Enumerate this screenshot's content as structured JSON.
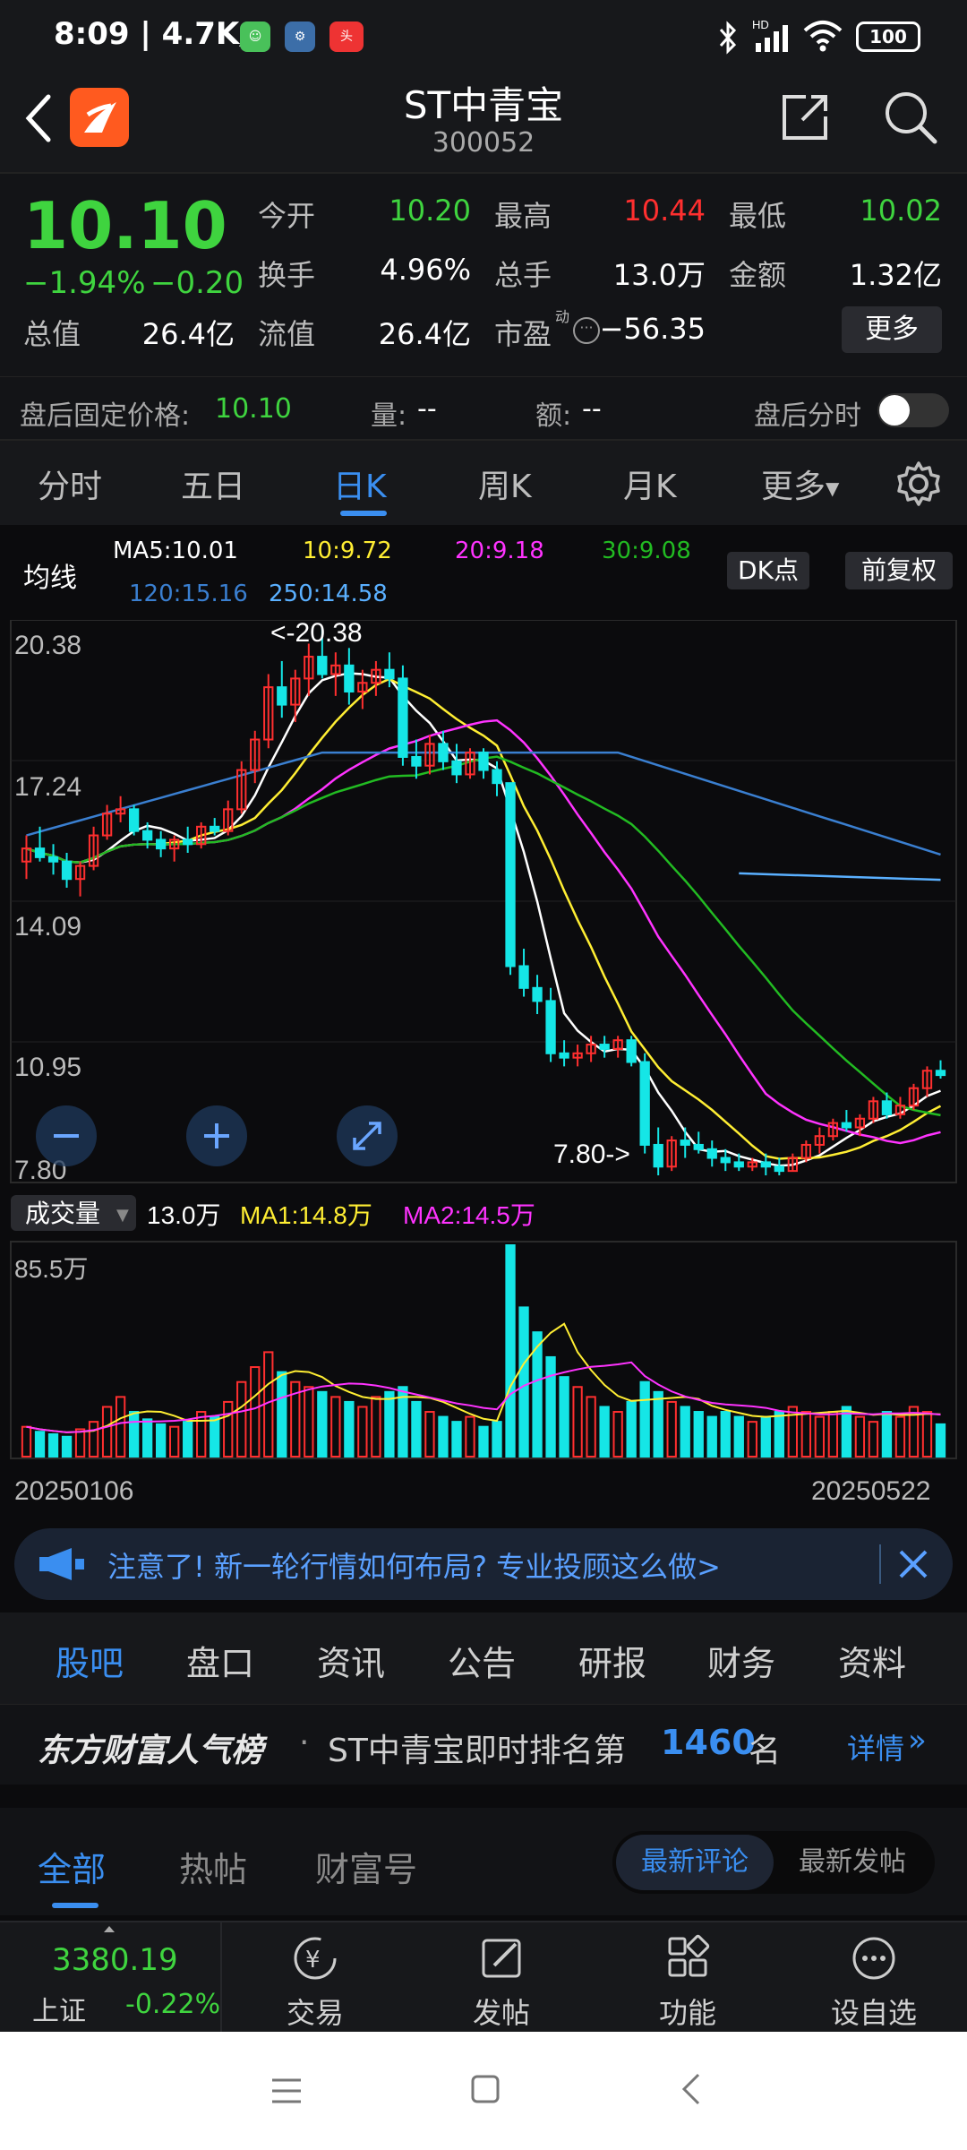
{
  "status": {
    "time": "8:09 | 4.7K/s",
    "battery": "100",
    "net": "HD"
  },
  "header": {
    "title": "ST中青宝",
    "code": "300052"
  },
  "quote": {
    "price": "10.10",
    "change_pct": "−1.94%",
    "change": "−0.20",
    "open_label": "今开",
    "open": "10.20",
    "high_label": "最高",
    "high": "10.44",
    "low_label": "最低",
    "low": "10.02",
    "turnover_label": "换手",
    "turnover": "4.96%",
    "volume_label": "总手",
    "volume": "13.0万",
    "amount_label": "金额",
    "amount": "1.32亿",
    "mktcap_label": "总值",
    "mktcap": "26.4亿",
    "float_label": "流值",
    "float": "26.4亿",
    "pe_label": "市盈",
    "pe_sup": "动",
    "pe": "−56.35",
    "more_button": "更多"
  },
  "after_hours": {
    "fixed_label": "盘后固定价格:",
    "fixed_value": "10.10",
    "qty_label": "量:",
    "qty_value": "--",
    "amt_label": "额:",
    "amt_value": "--",
    "intraday_label": "盘后分时"
  },
  "chart_tabs": [
    {
      "label": "分时"
    },
    {
      "label": "五日"
    },
    {
      "label": "日K"
    },
    {
      "label": "周K"
    },
    {
      "label": "月K"
    },
    {
      "label": "更多"
    }
  ],
  "ma_legend": {
    "label": "均线",
    "ma5": "MA5:10.01",
    "ma10": "10:9.72",
    "ma20": "20:9.18",
    "ma30": "30:9.08",
    "ma120": "120:15.16",
    "ma250": "250:14.58",
    "dk_button": "DK点",
    "adjust_button": "前复权"
  },
  "colors": {
    "up": "#ff2f2f",
    "down": "#15e6e6",
    "ma5": "#ffffff",
    "ma10": "#ffee33",
    "ma20": "#ff33ff",
    "ma30": "#22bb22",
    "ma120": "#3a7fd0",
    "ma250": "#5ab0ff",
    "accent": "#3a8ef0"
  },
  "chart_data": {
    "type": "candlestick",
    "y_ticks": [
      "20.38",
      "17.24",
      "14.09",
      "10.95",
      "7.80"
    ],
    "ylim": [
      7.8,
      20.38
    ],
    "max_marker": "<-20.38",
    "min_marker": "7.80->",
    "x_start": "20250106",
    "x_end": "20250522",
    "candles": [
      [
        15.0,
        15.6,
        14.6,
        15.3
      ],
      [
        15.3,
        15.8,
        15.0,
        15.1
      ],
      [
        15.1,
        15.4,
        14.7,
        15.0
      ],
      [
        15.0,
        15.2,
        14.4,
        14.6
      ],
      [
        14.6,
        15.0,
        14.2,
        14.9
      ],
      [
        14.9,
        15.8,
        14.8,
        15.6
      ],
      [
        15.6,
        16.3,
        15.5,
        16.1
      ],
      [
        16.1,
        16.5,
        15.9,
        16.2
      ],
      [
        16.2,
        16.3,
        15.6,
        15.7
      ],
      [
        15.7,
        15.9,
        15.3,
        15.5
      ],
      [
        15.5,
        15.7,
        15.1,
        15.3
      ],
      [
        15.3,
        15.6,
        15.0,
        15.5
      ],
      [
        15.5,
        15.8,
        15.2,
        15.4
      ],
      [
        15.4,
        15.9,
        15.3,
        15.8
      ],
      [
        15.8,
        16.0,
        15.6,
        15.7
      ],
      [
        15.7,
        16.4,
        15.6,
        16.2
      ],
      [
        16.2,
        17.3,
        16.1,
        17.1
      ],
      [
        17.1,
        18.0,
        16.8,
        17.8
      ],
      [
        17.8,
        19.3,
        17.6,
        19.0
      ],
      [
        19.0,
        19.6,
        18.3,
        18.6
      ],
      [
        18.6,
        19.4,
        18.2,
        19.2
      ],
      [
        19.2,
        20.0,
        18.8,
        19.7
      ],
      [
        19.7,
        20.38,
        19.2,
        19.3
      ],
      [
        19.3,
        19.8,
        18.8,
        19.5
      ],
      [
        19.5,
        19.9,
        18.6,
        18.9
      ],
      [
        18.9,
        19.4,
        18.5,
        19.1
      ],
      [
        19.1,
        19.6,
        18.8,
        19.4
      ],
      [
        19.4,
        19.8,
        19.0,
        19.2
      ],
      [
        19.2,
        19.5,
        17.2,
        17.4
      ],
      [
        17.4,
        17.8,
        16.9,
        17.2
      ],
      [
        17.2,
        17.9,
        17.0,
        17.7
      ],
      [
        17.7,
        18.0,
        17.1,
        17.3
      ],
      [
        17.3,
        17.7,
        16.8,
        17.0
      ],
      [
        17.0,
        17.6,
        16.9,
        17.5
      ],
      [
        17.5,
        17.6,
        16.9,
        17.1
      ],
      [
        17.1,
        17.3,
        16.5,
        16.8
      ],
      [
        16.8,
        14.0,
        12.4,
        12.6
      ],
      [
        12.6,
        13.0,
        11.9,
        12.1
      ],
      [
        12.1,
        12.4,
        11.5,
        11.8
      ],
      [
        11.8,
        12.1,
        10.4,
        10.6
      ],
      [
        10.6,
        10.9,
        10.3,
        10.5
      ],
      [
        10.5,
        10.8,
        10.3,
        10.6
      ],
      [
        10.6,
        11.0,
        10.4,
        10.8
      ],
      [
        10.8,
        11.0,
        10.5,
        10.7
      ],
      [
        10.7,
        11.0,
        10.5,
        10.9
      ],
      [
        10.9,
        11.0,
        10.3,
        10.4
      ],
      [
        10.4,
        10.6,
        8.3,
        8.5
      ],
      [
        8.5,
        8.9,
        7.8,
        8.0
      ],
      [
        8.0,
        8.7,
        7.9,
        8.6
      ],
      [
        8.6,
        8.9,
        8.2,
        8.5
      ],
      [
        8.5,
        8.8,
        8.3,
        8.4
      ],
      [
        8.4,
        8.6,
        8.0,
        8.2
      ],
      [
        8.2,
        8.4,
        7.9,
        8.1
      ],
      [
        8.1,
        8.3,
        7.9,
        8.0
      ],
      [
        8.0,
        8.2,
        7.9,
        8.1
      ],
      [
        8.1,
        8.3,
        7.8,
        8.0
      ],
      [
        8.0,
        8.2,
        7.8,
        7.9
      ],
      [
        7.9,
        8.3,
        7.9,
        8.2
      ],
      [
        8.2,
        8.6,
        8.1,
        8.5
      ],
      [
        8.5,
        8.9,
        8.3,
        8.7
      ],
      [
        8.7,
        9.1,
        8.6,
        9.0
      ],
      [
        9.0,
        9.3,
        8.8,
        8.9
      ],
      [
        8.9,
        9.2,
        8.7,
        9.1
      ],
      [
        9.1,
        9.6,
        9.0,
        9.5
      ],
      [
        9.5,
        9.7,
        9.1,
        9.2
      ],
      [
        9.2,
        9.6,
        9.1,
        9.4
      ],
      [
        9.4,
        9.9,
        9.3,
        9.8
      ],
      [
        9.8,
        10.3,
        9.6,
        10.2
      ],
      [
        10.2,
        10.44,
        10.02,
        10.1
      ]
    ],
    "volume": {
      "label": "成交量",
      "value": "13.0万",
      "ma1": "MA1:14.8万",
      "ma2": "MA2:14.5万",
      "max_label": "85.5万",
      "bars": [
        12,
        10,
        9,
        8,
        11,
        14,
        20,
        24,
        18,
        15,
        13,
        12,
        14,
        18,
        16,
        22,
        30,
        36,
        42,
        34,
        30,
        28,
        26,
        24,
        22,
        20,
        24,
        26,
        28,
        22,
        18,
        16,
        14,
        16,
        12,
        14,
        85,
        60,
        50,
        40,
        32,
        28,
        24,
        20,
        18,
        22,
        30,
        26,
        22,
        20,
        18,
        16,
        18,
        16,
        14,
        16,
        18,
        20,
        18,
        16,
        18,
        20,
        16,
        14,
        18,
        16,
        20,
        18,
        13
      ]
    }
  },
  "banner": {
    "text": "注意了! 新一轮行情如何布局? 专业投顾这么做>"
  },
  "bar_tabs": [
    {
      "label": "股吧"
    },
    {
      "label": "盘口"
    },
    {
      "label": "资讯"
    },
    {
      "label": "公告"
    },
    {
      "label": "研报"
    },
    {
      "label": "财务"
    },
    {
      "label": "资料"
    }
  ],
  "rank": {
    "brand": "东方财富人气榜",
    "text": "ST中青宝即时排名第",
    "number": "1460",
    "unit": "名",
    "detail": "详情"
  },
  "filter": {
    "tabs": [
      {
        "label": "全部"
      },
      {
        "label": "热帖"
      },
      {
        "label": "财富号"
      }
    ],
    "sort_a": "最新评论",
    "sort_b": "最新发帖"
  },
  "bottom_nav": {
    "index_value": "3380.19",
    "index_name": "上证",
    "index_change": "-0.22%",
    "items": [
      {
        "label": "交易"
      },
      {
        "label": "发帖"
      },
      {
        "label": "功能"
      },
      {
        "label": "设自选"
      }
    ]
  }
}
